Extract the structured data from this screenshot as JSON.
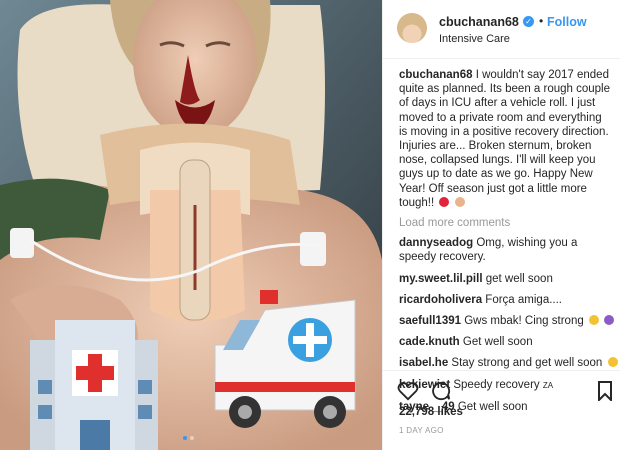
{
  "post": {
    "username": "cbuchanan68",
    "verified_icon": "verified-badge-icon",
    "separator": "•",
    "follow_label": "Follow",
    "location": "Intensive Care",
    "caption": "I wouldn't say 2017 ended quite as planned. Its been a rough couple of days in ICU after a vehicle roll. I just moved to a private room and everything is moving in a positive recovery direction. Injuries are... Broken sternum, broken nose, collapsed lungs. I'll will keep you guys up to date as we go. Happy New Year! Off season just got a little more tough!!",
    "caption_emojis": [
      "red-heart-icon",
      "flexed-biceps-icon"
    ],
    "load_more_label": "Load more comments",
    "comments": [
      {
        "user": "dannyseadog",
        "text": "Omg, wishing you a speedy recovery."
      },
      {
        "user": "my.sweet.lil.pill",
        "text": "get well soon"
      },
      {
        "user": "ricardoholivera",
        "text": "Força amiga...."
      },
      {
        "user": "saefull1391",
        "text": "Gws mbak! Cing strong"
      },
      {
        "user": "cade.knuth",
        "text": "Get well soon"
      },
      {
        "user": "isabel.he",
        "text": "Stay strong and get well soon"
      },
      {
        "user": "kckiewiet",
        "text": "Speedy recovery",
        "suffix": "ZA"
      },
      {
        "user": "tayne__49",
        "text": "Get well soon"
      }
    ],
    "likes": "22,798 likes",
    "time_ago": "1 DAY AGO",
    "action_icons": [
      "heart-icon",
      "comment-icon",
      "bookmark-icon"
    ],
    "photo_stickers": [
      "hospital-icon",
      "ambulance-icon"
    ],
    "carousel": {
      "total": 2,
      "active": 1
    },
    "accent_color": "#3897f0"
  }
}
